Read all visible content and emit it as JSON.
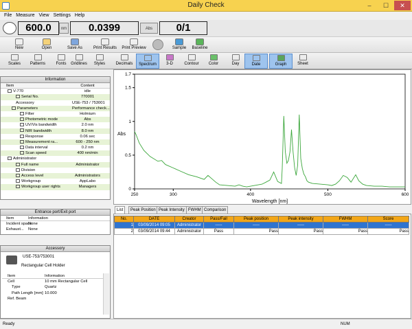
{
  "window": {
    "title": "Daily Check",
    "min": "–",
    "max": "☐",
    "close": "✕"
  },
  "menu": [
    "File",
    "Measure",
    "View",
    "Settings",
    "Help"
  ],
  "readouts": {
    "wavelength": "600.0",
    "wl_unit": "nm",
    "value": "0.0399",
    "val_unit": "Abs",
    "count": "0/1"
  },
  "toolbar1": [
    {
      "label": "New",
      "icon": "new-file-icon"
    },
    {
      "label": "Open",
      "icon": "open-folder-icon"
    },
    {
      "label": "Save As",
      "icon": "save-icon"
    },
    {
      "label": "Print Results",
      "icon": "print-icon"
    },
    {
      "label": "Print Preview",
      "icon": "print-preview-icon"
    },
    {
      "label": "Sample",
      "icon": "sample-icon"
    },
    {
      "label": "Baseline",
      "icon": "baseline-icon"
    }
  ],
  "toolbar2": [
    {
      "label": "Scales",
      "icon": "scales-icon"
    },
    {
      "label": "Patterns",
      "icon": "patterns-icon"
    },
    {
      "label": "Fonts",
      "icon": "fonts-icon"
    },
    {
      "label": "Gridlines",
      "icon": "gridlines-icon"
    },
    {
      "label": "Styles",
      "icon": "styles-icon"
    },
    {
      "label": "Decimals",
      "icon": "decimals-icon"
    },
    {
      "label": "Spectrum",
      "icon": "spectrum-icon",
      "on": true
    },
    {
      "label": "3-D",
      "icon": "3d-icon"
    },
    {
      "label": "Contour",
      "icon": "contour-icon"
    },
    {
      "label": "Color",
      "icon": "color-icon"
    },
    {
      "label": "Day",
      "icon": "day-icon"
    },
    {
      "label": "Date",
      "icon": "date-icon",
      "on": true
    },
    {
      "label": "Graph",
      "icon": "graph-icon",
      "on": true
    },
    {
      "label": "Sheet",
      "icon": "sheet-icon"
    }
  ],
  "info": {
    "title": "Information",
    "col_item": "Item",
    "col_content": "Content",
    "rows": [
      {
        "k": "V-770",
        "v": "idle",
        "d": 1,
        "icon": "instrument-icon"
      },
      {
        "k": "Serial No.",
        "v": "770001",
        "d": 3,
        "icon": "serial-icon"
      },
      {
        "k": "Accessory",
        "v": "USE-753 / 753001",
        "d": 3,
        "icon": ""
      },
      {
        "k": "Parameters",
        "v": "Performance check...",
        "d": 2,
        "icon": "parameters-icon"
      },
      {
        "k": "Filter",
        "v": "Holmium",
        "d": 4,
        "icon": "doc-icon"
      },
      {
        "k": "Photometric mode",
        "v": "Abs",
        "d": 4,
        "icon": "doc-icon"
      },
      {
        "k": "UV/Vis bandwidth",
        "v": "2.0 nm",
        "d": 4,
        "icon": "doc-icon"
      },
      {
        "k": "NIR bandwidth",
        "v": "8.0 nm",
        "d": 4,
        "icon": "doc-icon"
      },
      {
        "k": "Response",
        "v": "0.06 sec",
        "d": 4,
        "icon": "doc-icon"
      },
      {
        "k": "Measurement ra...",
        "v": "600 - 250 nm",
        "d": 4,
        "icon": "doc-icon"
      },
      {
        "k": "Data interval",
        "v": "0.2 nm",
        "d": 4,
        "icon": "doc-icon"
      },
      {
        "k": "Scan speed",
        "v": "400 nm/min",
        "d": 4,
        "icon": "doc-icon"
      },
      {
        "k": "Administrator",
        "v": "",
        "d": 1,
        "icon": "user-icon"
      },
      {
        "k": "Full name",
        "v": "Administrator",
        "d": 3,
        "icon": "doc-icon"
      },
      {
        "k": "Division",
        "v": "",
        "d": 3,
        "icon": "doc-icon"
      },
      {
        "k": "Access level",
        "v": "Administrators",
        "d": 3,
        "icon": "doc-icon"
      },
      {
        "k": "Workgroup",
        "v": "AppLabo",
        "d": 3,
        "icon": "workgroup-icon"
      },
      {
        "k": "Workgroup user rights",
        "v": "Managers",
        "d": 3,
        "icon": "workgroup-icon"
      }
    ]
  },
  "entrance": {
    "title": "Entrance port/Exit port",
    "col_item": "Item",
    "col_info": "Information",
    "rows": [
      {
        "k": "Incident space",
        "v": "None"
      },
      {
        "k": "Exhaust...",
        "v": "None"
      }
    ]
  },
  "accessory": {
    "title": "Accessory",
    "model": "USE-753/753001",
    "name": "Rectangular Cell Holder",
    "col_item": "Item",
    "col_info": "Information",
    "rows": [
      {
        "k": "Cell",
        "v": "10 mm Rectangular Cell"
      },
      {
        "k": "Type",
        "v": "Quartz"
      },
      {
        "k": "Path Length [mm]",
        "v": "10.000"
      },
      {
        "k": "Ref. Beam",
        "v": ""
      }
    ]
  },
  "chart_data": {
    "type": "line",
    "xlabel": "Wavelength [nm]",
    "ylabel": "Abs",
    "xlim": [
      250,
      600
    ],
    "ylim": [
      0,
      1.7
    ],
    "xticks": [
      250,
      300,
      400,
      500,
      600
    ],
    "yticks": [
      0,
      0.5,
      1,
      1.5,
      1.7
    ],
    "color": "#3aa63a",
    "x": [
      250,
      252,
      256,
      262,
      270,
      280,
      285,
      290,
      300,
      310,
      320,
      330,
      340,
      345,
      350,
      355,
      360,
      370,
      380,
      385,
      390,
      395,
      400,
      405,
      410,
      415,
      420,
      425,
      430,
      435,
      440,
      441,
      443,
      445,
      447,
      449,
      451,
      453,
      455,
      457,
      459,
      461,
      463,
      465,
      467,
      469,
      471,
      473,
      475,
      480,
      490,
      500,
      505,
      510,
      515,
      520,
      525,
      530,
      536,
      540,
      545,
      550,
      560,
      570,
      580,
      590,
      600
    ],
    "y": [
      0.85,
      0.8,
      0.68,
      0.57,
      0.48,
      0.41,
      0.42,
      0.36,
      0.31,
      0.26,
      0.21,
      0.18,
      0.14,
      0.2,
      0.15,
      0.1,
      0.06,
      0.05,
      0.04,
      0.06,
      0.04,
      0.03,
      0.04,
      0.05,
      0.06,
      0.07,
      0.1,
      0.13,
      0.25,
      0.11,
      0.08,
      0.3,
      1.08,
      0.55,
      0.38,
      0.42,
      0.55,
      0.88,
      0.55,
      0.32,
      0.2,
      0.35,
      1.1,
      0.45,
      0.3,
      0.22,
      0.18,
      0.12,
      0.1,
      0.08,
      0.07,
      0.06,
      0.05,
      0.07,
      0.12,
      0.2,
      0.17,
      0.1,
      0.21,
      0.12,
      0.07,
      0.05,
      0.04,
      0.04,
      0.03,
      0.03,
      0.03
    ]
  },
  "listtabs": [
    "List",
    "Peak Position",
    "Peak Intensity",
    "FWHM",
    "Comparison"
  ],
  "table": {
    "headers": [
      "No.",
      "DATE",
      "Creator",
      "Pass/Fail",
      "Peak position",
      "Peak intensity",
      "FWHM",
      "Score"
    ],
    "rows": [
      [
        "1",
        "03/09/2014 09:05",
        "Administrator",
        "-----",
        "-----",
        "-----",
        "-----",
        "-----"
      ],
      [
        "2",
        "03/09/2014 09:44",
        "Administrator",
        "Pass",
        "Pass",
        "Pass",
        "Pass",
        "Pass"
      ]
    ]
  },
  "status": {
    "left": "Ready",
    "num": "NUM"
  }
}
